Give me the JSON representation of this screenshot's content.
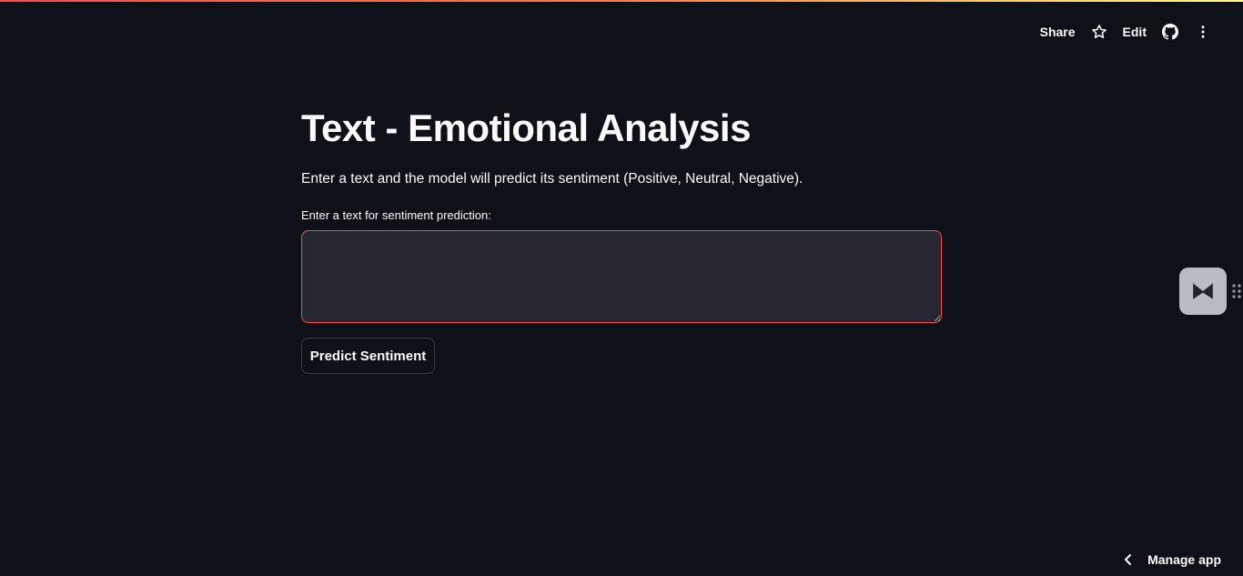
{
  "header": {
    "share_label": "Share",
    "edit_label": "Edit",
    "icons": [
      "star-icon",
      "github-icon",
      "more-vertical-icon"
    ]
  },
  "main": {
    "title": "Text - Emotional Analysis",
    "description": "Enter a text and the model will predict its sentiment (Positive, Neutral, Negative).",
    "input_label": "Enter a text for sentiment prediction:",
    "input_value": "",
    "button_label": "Predict Sentiment"
  },
  "footer": {
    "manage_app_label": "Manage app"
  },
  "colors": {
    "background": "#0e1117",
    "accent": "#ff4b4b",
    "input_background": "#262730",
    "text": "#fafafa"
  }
}
